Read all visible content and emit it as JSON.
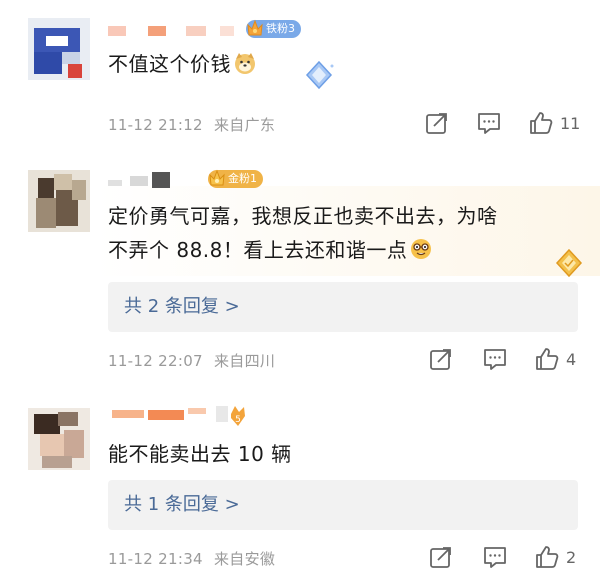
{
  "comments": [
    {
      "fan_badge": "铁粉3",
      "text": "不值这个价钱",
      "time": "11-12 21:12",
      "location": "来自广东",
      "likes": "11",
      "colors": {
        "badge": "#7aa9e8"
      }
    },
    {
      "fan_badge": "金粉1",
      "text_line1": "定价勇气可嘉，我想反正也卖不出去，为啥",
      "text_line2": "不弄个 88.8！看上去还和谐一点",
      "reply_label": "共 2 条回复 >",
      "time": "11-12 22:07",
      "location": "来自四川",
      "likes": "4",
      "colors": {
        "badge": "#f0b347",
        "highlight": "#fdf6e8"
      }
    },
    {
      "fan_badge": "",
      "text": "能不能卖出去 10 辆",
      "reply_label": "共 1 条回复 >",
      "time": "11-12 21:34",
      "location": "来自安徽",
      "likes": "2"
    }
  ]
}
